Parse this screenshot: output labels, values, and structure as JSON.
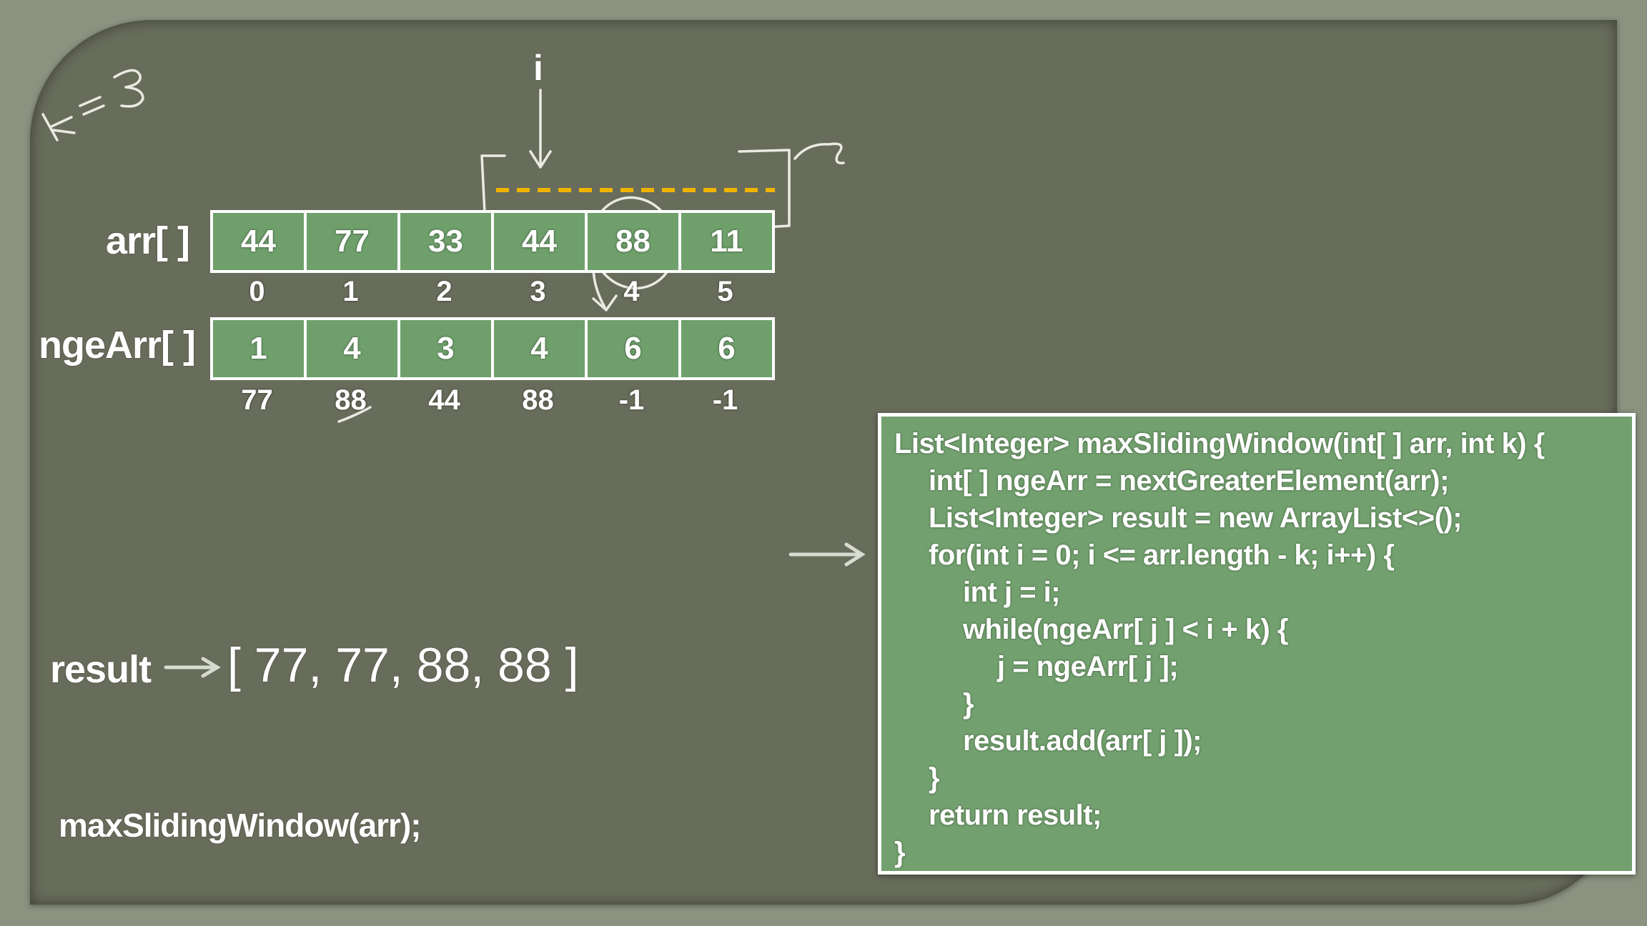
{
  "annotation_k": "k = 3",
  "pointer_label": "i",
  "arr_label": "arr[ ]",
  "nge_label": "ngeArr[ ]",
  "arr_values": [
    "44",
    "77",
    "33",
    "44",
    "88",
    "11"
  ],
  "indices": [
    "0",
    "1",
    "2",
    "3",
    "4",
    "5"
  ],
  "nge_values": [
    "1",
    "4",
    "3",
    "4",
    "6",
    "6"
  ],
  "nge_element_values": [
    "77",
    "88",
    "44",
    "88",
    "-1",
    "-1"
  ],
  "result_label": "result",
  "result_value": "[ 77, 77, 88, 88 ]",
  "call": "maxSlidingWindow(arr);",
  "code": [
    "List<Integer> maxSlidingWindow(int[ ] arr, int k) {",
    "int[ ] ngeArr = nextGreaterElement(arr);",
    "List<Integer> result = new ArrayList<>();",
    "for(int i = 0; i <= arr.length - k; i++) {",
    "int j = i;",
    "while(ngeArr[ j ] < i + k) {",
    "j = ngeArr[ j ];",
    "}",
    "result.add(arr[ j ]);",
    "}",
    "return result;",
    "}"
  ],
  "colors": {
    "board": "#686c5b",
    "frame": "#8c9280",
    "cell_fill": "#6fa06c",
    "code_fill": "#72a06e",
    "window_dashes": "#f0b400",
    "chalk": "#ffffff"
  }
}
